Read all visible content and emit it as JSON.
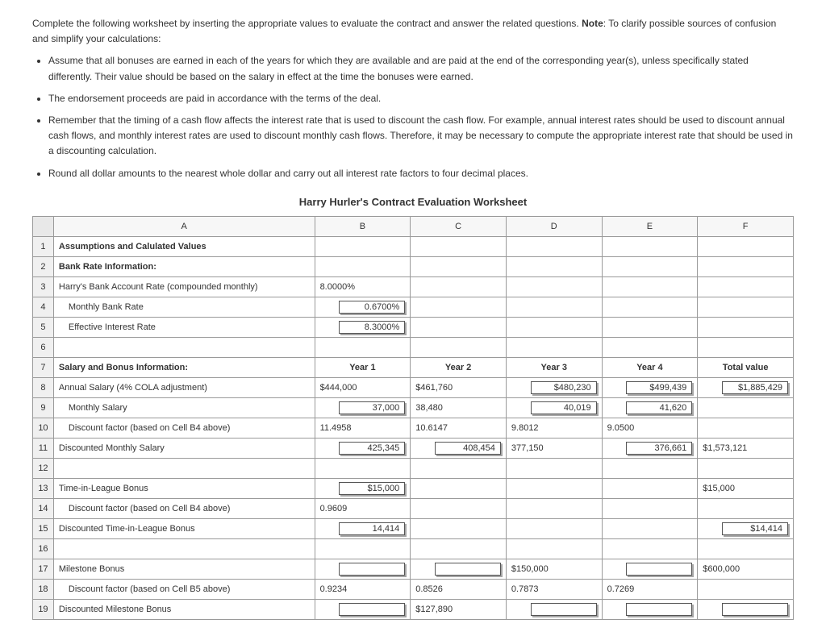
{
  "intro": {
    "lead": "Complete the following worksheet by inserting the appropriate values to evaluate the contract and answer the related questions. ",
    "note_label": "Note",
    "note_tail": ": To clarify possible sources of confusion and simplify your calculations:",
    "bullets": [
      "Assume that all bonuses are earned in each of the years for which they are available and are paid at the end of the corresponding year(s), unless specifically stated differently. Their value should be based on the salary in effect at the time the bonuses were earned.",
      "The endorsement proceeds are paid in accordance with the terms of the deal.",
      "Remember that the timing of a cash flow affects the interest rate that is used to discount the cash flow. For example, annual interest rates should be used to discount annual cash flows, and monthly interest rates are used to discount monthly cash flows. Therefore, it may be necessary to compute the appropriate interest rate that should be used in a discounting calculation.",
      "Round all dollar amounts to the nearest whole dollar and carry out all interest rate factors to four decimal places."
    ]
  },
  "worksheet_title": "Harry Hurler's Contract Evaluation Worksheet",
  "cols": {
    "A": "A",
    "B": "B",
    "C": "C",
    "D": "D",
    "E": "E",
    "F": "F"
  },
  "rows": {
    "r1": {
      "a": "Assumptions and Calulated Values"
    },
    "r2": {
      "a": "Bank Rate Information:"
    },
    "r3": {
      "a": "Harry's Bank Account Rate (compounded monthly)",
      "b": "8.0000%"
    },
    "r4": {
      "a": "Monthly Bank Rate",
      "b": "0.6700%"
    },
    "r5": {
      "a": "Effective Interest Rate",
      "b": "8.3000%"
    },
    "r6": {
      "a": ""
    },
    "r7": {
      "a": "Salary and Bonus Information:",
      "b": "Year 1",
      "c": "Year 2",
      "d": "Year 3",
      "e": "Year 4",
      "f": "Total value"
    },
    "r8": {
      "a": "Annual Salary (4% COLA adjustment)",
      "b": "$444,000",
      "c": "$461,760",
      "d": "$480,230",
      "e": "$499,439",
      "f": "$1,885,429"
    },
    "r9": {
      "a": "Monthly Salary",
      "b": "37,000",
      "c": "38,480",
      "d": "40,019",
      "e": "41,620"
    },
    "r10": {
      "a": "Discount factor (based on Cell B4 above)",
      "b": "11.4958",
      "c": "10.6147",
      "d": "9.8012",
      "e": "9.0500"
    },
    "r11": {
      "a": "Discounted Monthly Salary",
      "b": "425,345",
      "c": "408,454",
      "d": "377,150",
      "e": "376,661",
      "f": "$1,573,121"
    },
    "r12": {
      "a": ""
    },
    "r13": {
      "a": "Time-in-League Bonus",
      "b": "$15,000",
      "f": "$15,000"
    },
    "r14": {
      "a": "Discount factor (based on Cell B4 above)",
      "b": "0.9609"
    },
    "r15": {
      "a": "Discounted Time-in-League Bonus",
      "b": "14,414",
      "f": "$14,414"
    },
    "r16": {
      "a": ""
    },
    "r17": {
      "a": "Milestone Bonus",
      "d": "$150,000",
      "f": "$600,000"
    },
    "r18": {
      "a": "Discount factor (based on Cell B5 above)",
      "b": "0.9234",
      "c": "0.8526",
      "d": "0.7873",
      "e": "0.7269"
    },
    "r19": {
      "a": "Discounted Milestone Bonus",
      "c": "$127,890"
    }
  }
}
